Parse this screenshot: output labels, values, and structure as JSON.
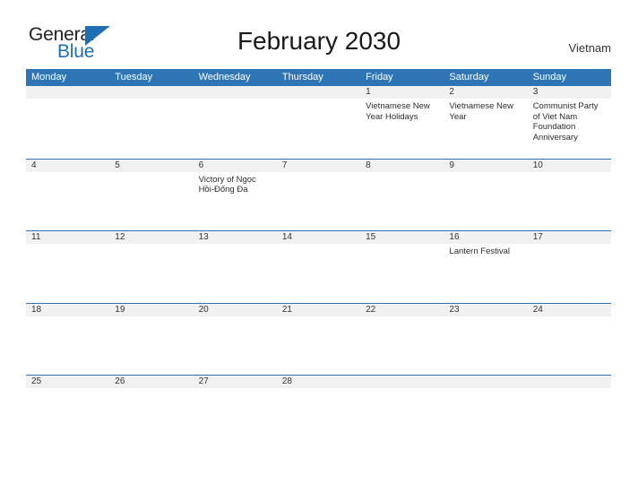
{
  "brand": {
    "name_part1": "General",
    "name_part2": "Blue",
    "accent_color": "#1f6fb5"
  },
  "header": {
    "title": "February 2030",
    "country": "Vietnam"
  },
  "calendar": {
    "header_color": "#2e75b6",
    "band_color": "#f1f1f1",
    "weekdays": [
      "Monday",
      "Tuesday",
      "Wednesday",
      "Thursday",
      "Friday",
      "Saturday",
      "Sunday"
    ],
    "weeks": [
      {
        "days": [
          {
            "number": "",
            "events": []
          },
          {
            "number": "",
            "events": []
          },
          {
            "number": "",
            "events": []
          },
          {
            "number": "",
            "events": []
          },
          {
            "number": "1",
            "events": [
              "Vietnamese New Year Holidays"
            ]
          },
          {
            "number": "2",
            "events": [
              "Vietnamese New Year"
            ]
          },
          {
            "number": "3",
            "events": [
              "Communist Party of Viet Nam Foundation Anniversary"
            ]
          }
        ]
      },
      {
        "days": [
          {
            "number": "4",
            "events": []
          },
          {
            "number": "5",
            "events": []
          },
          {
            "number": "6",
            "events": [
              "Victory of Ngọc Hồi-Đống Đa"
            ]
          },
          {
            "number": "7",
            "events": []
          },
          {
            "number": "8",
            "events": []
          },
          {
            "number": "9",
            "events": []
          },
          {
            "number": "10",
            "events": []
          }
        ]
      },
      {
        "days": [
          {
            "number": "11",
            "events": []
          },
          {
            "number": "12",
            "events": []
          },
          {
            "number": "13",
            "events": []
          },
          {
            "number": "14",
            "events": []
          },
          {
            "number": "15",
            "events": []
          },
          {
            "number": "16",
            "events": [
              "Lantern Festival"
            ]
          },
          {
            "number": "17",
            "events": []
          }
        ]
      },
      {
        "days": [
          {
            "number": "18",
            "events": []
          },
          {
            "number": "19",
            "events": []
          },
          {
            "number": "20",
            "events": []
          },
          {
            "number": "21",
            "events": []
          },
          {
            "number": "22",
            "events": []
          },
          {
            "number": "23",
            "events": []
          },
          {
            "number": "24",
            "events": []
          }
        ]
      },
      {
        "days": [
          {
            "number": "25",
            "events": []
          },
          {
            "number": "26",
            "events": []
          },
          {
            "number": "27",
            "events": []
          },
          {
            "number": "28",
            "events": []
          },
          {
            "number": "",
            "events": []
          },
          {
            "number": "",
            "events": []
          },
          {
            "number": "",
            "events": []
          }
        ]
      }
    ]
  }
}
